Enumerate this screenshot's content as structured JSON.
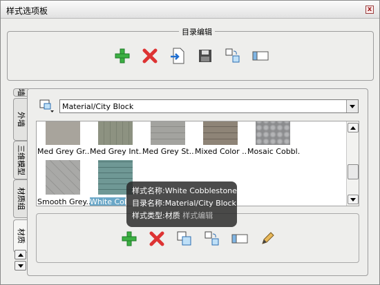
{
  "window": {
    "title": "样式选项板",
    "close_glyph": "x"
  },
  "top_group": {
    "legend": "目录编辑",
    "buttons": [
      {
        "name": "add-button",
        "icon": "plus-icon"
      },
      {
        "name": "delete-button",
        "icon": "x-icon"
      },
      {
        "name": "import-button",
        "icon": "import-icon"
      },
      {
        "name": "save-button",
        "icon": "floppy-icon"
      },
      {
        "name": "transfer-button",
        "icon": "cubes-icon"
      },
      {
        "name": "view-button",
        "icon": "rectangle-icon"
      }
    ]
  },
  "tabs": [
    {
      "label": "墙"
    },
    {
      "label": "外墙"
    },
    {
      "label": "三维模型"
    },
    {
      "label": "材质组"
    },
    {
      "label": "材质"
    }
  ],
  "category": {
    "value": "Material/City Block",
    "icon": "style-selector-icon"
  },
  "gallery": {
    "items": [
      {
        "label": "Med Grey Gr...",
        "color": "#a8a49c"
      },
      {
        "label": "Med Grey Int...",
        "color": "#8d9281"
      },
      {
        "label": "Med Grey St...",
        "color": "#a3a39f"
      },
      {
        "label": "Mixed Color ...",
        "color": "#8e8477"
      },
      {
        "label": "Mosaic Cobbl...",
        "color": "#9b9c9e"
      },
      {
        "label": "Smooth Grey...",
        "color": "#a9a9a7"
      },
      {
        "label": "White Cobbl...",
        "color": "#6f9895"
      }
    ]
  },
  "tooltip": {
    "rows": [
      {
        "key": "样式名称:",
        "value": "White Cobblestone"
      },
      {
        "key": "目录名称:",
        "value": "Material/City Block"
      },
      {
        "key": "样式类型:",
        "value": "材质"
      }
    ],
    "hidden_tail": "样式编辑"
  },
  "bottom_group": {
    "buttons": [
      {
        "name": "add-style-button",
        "icon": "plus-icon"
      },
      {
        "name": "remove-style-button",
        "icon": "x-icon"
      },
      {
        "name": "copy-style-button",
        "icon": "copy-icon"
      },
      {
        "name": "transfer-style-button",
        "icon": "cubes-icon"
      },
      {
        "name": "rename-style-button",
        "icon": "rectangle-icon"
      },
      {
        "name": "edit-style-button",
        "icon": "pencil-icon"
      }
    ]
  }
}
